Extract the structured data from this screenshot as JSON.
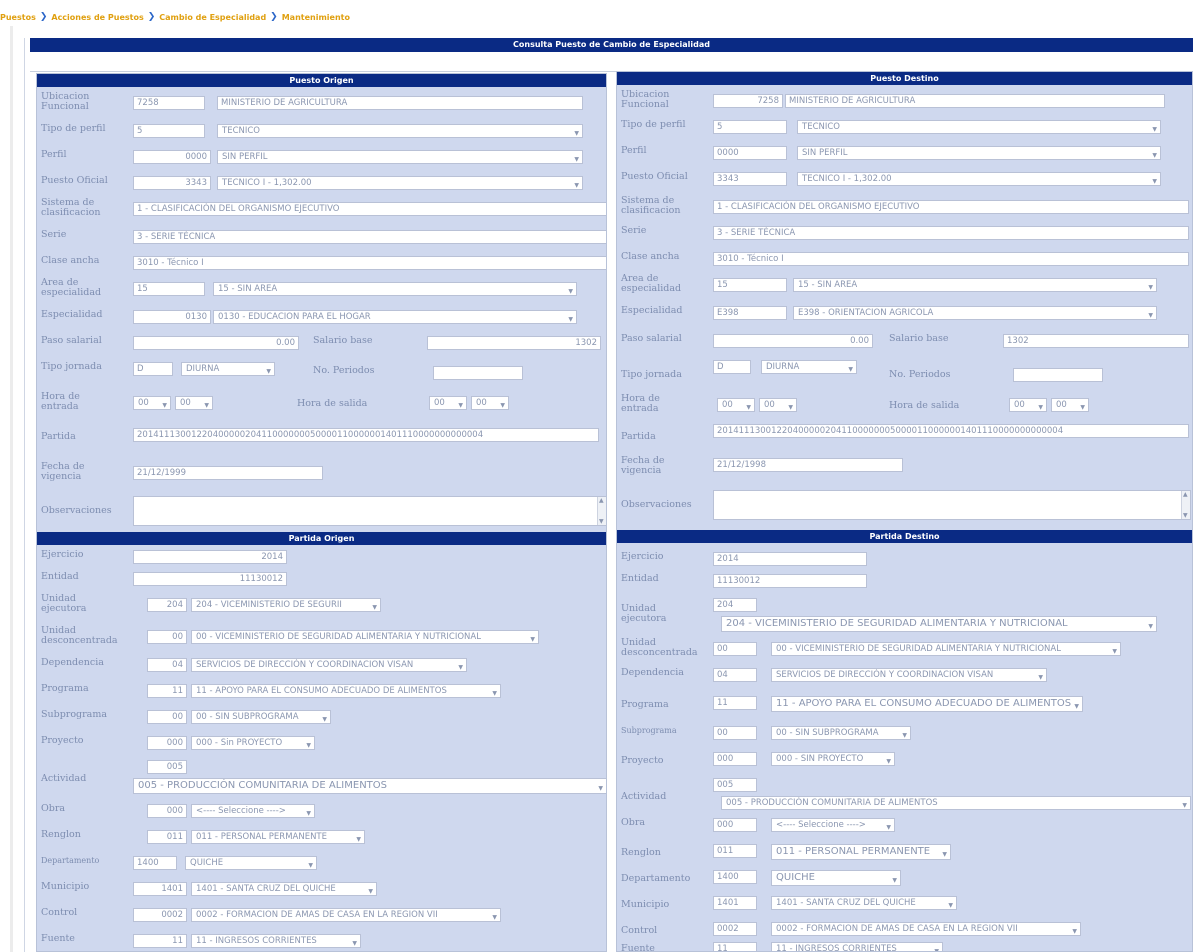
{
  "breadcrumb": [
    "Puestos",
    "Acciones de Puestos",
    "Cambio de Especialidad",
    "Mantenimiento"
  ],
  "page_title": "Consulta Puesto de Cambio de Especialidad",
  "origen": {
    "title": "Puesto Origen",
    "labels": {
      "ubicacion": "Ubicacion Funcional",
      "tipo_perfil": "Tipo de perfil",
      "perfil": "Perfil",
      "puesto_oficial": "Puesto Oficial",
      "sistema": "Sistema de clasificacion",
      "serie": "Serie",
      "clase_ancha": "Clase ancha",
      "area": "Area de especialidad",
      "especialidad": "Especialidad",
      "paso_salarial": "Paso salarial",
      "salario_base": "Salario base",
      "tipo_jornada": "Tipo jornada",
      "no_periodos": "No. Periodos",
      "hora_entrada": "Hora de entrada",
      "hora_salida": "Hora de salida",
      "partida": "Partida",
      "fecha_vigencia": "Fecha de vigencia",
      "observaciones": "Observaciones"
    },
    "values": {
      "ubicacion_code": "7258",
      "ubicacion_desc": "MINISTERIO DE AGRICULTURA",
      "tipo_perfil_code": "5",
      "tipo_perfil_desc": "TECNICO",
      "perfil_code": "0000",
      "perfil_desc": "SIN PERFIL",
      "puesto_code": "3343",
      "puesto_desc": "TECNICO I - 1,302.00",
      "sistema": "1 - CLASIFICACIÓN DEL ORGANISMO EJECUTIVO",
      "serie": "3 - SERIE TÉCNICA",
      "clase_ancha": "3010 - Técnico I",
      "area_code": "15",
      "area_desc": "15 - SIN AREA",
      "especialidad_code": "0130",
      "especialidad_desc": "0130 - EDUCACION PARA EL HOGAR",
      "paso_salarial": "0.00",
      "salario_base": "1302",
      "jornada_code": "D",
      "jornada_desc": "DIURNA",
      "no_periodos": "",
      "hora_entrada_h": "00",
      "hora_entrada_m": "00",
      "hora_salida_h": "00",
      "hora_salida_m": "00",
      "partida": "2014111300122040000020411000000050000110000001401110000000000004",
      "fecha_vigencia": "21/12/1999"
    }
  },
  "destino": {
    "title": "Puesto Destino",
    "labels": {
      "ubicacion": "Ubicacion Funcional",
      "tipo_perfil": "Tipo de perfil",
      "perfil": "Perfil",
      "puesto_oficial": "Puesto Oficial",
      "sistema": "Sistema de clasificacion",
      "serie": "Serie",
      "clase_ancha": "Clase ancha",
      "area": "Area de especialidad",
      "especialidad": "Especialidad",
      "paso_salarial": "Paso salarial",
      "salario_base": "Salario base",
      "tipo_jornada": "Tipo jornada",
      "no_periodos": "No. Periodos",
      "hora_entrada": "Hora de entrada",
      "hora_salida": "Hora de salida",
      "partida": "Partida",
      "fecha_vigencia": "Fecha de vigencia",
      "observaciones": "Observaciones"
    },
    "values": {
      "ubicacion_code": "7258",
      "ubicacion_desc": "MINISTERIO DE AGRICULTURA",
      "tipo_perfil_code": "5",
      "tipo_perfil_desc": "TECNICO",
      "perfil_code": "0000",
      "perfil_desc": "SIN PERFIL",
      "puesto_code": "3343",
      "puesto_desc": "TECNICO I - 1,302.00",
      "sistema": "1 - CLASIFICACIÓN DEL ORGANISMO EJECUTIVO",
      "serie": "3 - SERIE TÉCNICA",
      "clase_ancha": "3010 - Técnico I",
      "area_code": "15",
      "area_desc": "15 - SIN AREA",
      "especialidad_code": "E398",
      "especialidad_desc": "E398 - ORIENTACION AGRICOLA",
      "paso_salarial": "0.00",
      "salario_base": "1302",
      "jornada_code": "D",
      "jornada_desc": "DIURNA",
      "no_periodos": "",
      "hora_entrada_h": "00",
      "hora_entrada_m": "00",
      "hora_salida_h": "00",
      "hora_salida_m": "00",
      "partida": "2014111300122040000020411000000050000110000001401110000000000004",
      "fecha_vigencia": "21/12/1998"
    }
  },
  "partida_origen": {
    "title": "Partida Origen",
    "labels": {
      "ejercicio": "Ejercicio",
      "entidad": "Entidad",
      "unidad_ejecutora": "Unidad ejecutora",
      "unidad_desconcentrada": "Unidad desconcentrada",
      "dependencia": "Dependencia",
      "programa": "Programa",
      "subprograma": "Subprograma",
      "proyecto": "Proyecto",
      "actividad": "Actividad",
      "obra": "Obra",
      "renglon": "Renglon",
      "departamento": "Departamento",
      "municipio": "Municipio",
      "control": "Control",
      "fuente": "Fuente"
    },
    "values": {
      "ejercicio": "2014",
      "entidad": "11130012",
      "ue_code": "204",
      "ue_desc": "204 - VICEMINISTERIO DE SEGURII",
      "ud_code": "00",
      "ud_desc": "00 - VICEMINISTERIO DE SEGURIDAD ALIMENTARIA Y NUTRICIONAL",
      "dep_code": "04",
      "dep_desc": "SERVICIOS DE DIRECCIÓN Y COORDINACION VISAN",
      "prog_code": "11",
      "prog_desc": "11 - APOYO PARA EL CONSUMO ADECUADO DE ALIMENTOS",
      "subprog_code": "00",
      "subprog_desc": "00 - SIN SUBPROGRAMA",
      "proy_code": "000",
      "proy_desc": "000 - Sin PROYECTO",
      "act_code": "005",
      "act_desc": "005 - PRODUCCIÓN COMUNITARIA DE ALIMENTOS",
      "obra_code": "000",
      "obra_desc": "<---- Seleccione ---->",
      "renglon_code": "011",
      "renglon_desc": "011 - PERSONAL PERMANENTE",
      "depto_code": "1400",
      "depto_desc": "QUICHE",
      "muni_code": "1401",
      "muni_desc": "1401 - SANTA CRUZ DEL QUICHE",
      "control_code": "0002",
      "control_desc": "0002 - FORMACION DE AMAS DE CASA EN LA REGION VII",
      "fuente_code": "11",
      "fuente_desc": "11 - INGRESOS CORRIENTES"
    }
  },
  "partida_destino": {
    "title": "Partida Destino",
    "labels": {
      "ejercicio": "Ejercicio",
      "entidad": "Entidad",
      "unidad_ejecutora": "Unidad ejecutora",
      "unidad_desconcentrada": "Unidad desconcentrada",
      "dependencia": "Dependencia",
      "programa": "Programa",
      "subprograma": "Subprograma",
      "proyecto": "Proyecto",
      "actividad": "Actividad",
      "obra": "Obra",
      "renglon": "Renglon",
      "departamento": "Departamento",
      "municipio": "Municipio",
      "control": "Control",
      "fuente": "Fuente"
    },
    "values": {
      "ejercicio": "2014",
      "entidad": "11130012",
      "ue_code": "204",
      "ue_desc": "204 - VICEMINISTERIO DE SEGURIDAD ALIMENTARIA Y NUTRICIONAL",
      "ud_code": "00",
      "ud_desc": "00 - VICEMINISTERIO DE SEGURIDAD ALIMENTARIA Y NUTRICIONAL",
      "dep_code": "04",
      "dep_desc": "SERVICIOS DE DIRECCIÓN Y COORDINACION VISAN",
      "prog_code": "11",
      "prog_desc": "11 - APOYO PARA EL CONSUMO ADECUADO DE ALIMENTOS",
      "subprog_code": "00",
      "subprog_desc": "00 - SIN SUBPROGRAMA",
      "proy_code": "000",
      "proy_desc": "000 - SIN PROYECTO",
      "act_code": "005",
      "act_desc": "005 - PRODUCCIÓN COMUNITARIA DE ALIMENTOS",
      "obra_code": "000",
      "obra_desc": "<---- Seleccione ---->",
      "renglon_code": "011",
      "renglon_desc": "011 - PERSONAL PERMANENTE",
      "depto_code": "1400",
      "depto_desc": "QUICHE",
      "muni_code": "1401",
      "muni_desc": "1401 - SANTA CRUZ DEL QUICHE",
      "control_code": "0002",
      "control_desc": "0002 - FORMACION DE AMAS DE CASA EN LA REGION VII",
      "fuente_code": "11",
      "fuente_desc": "11 - INGRESOS CORRIENTES"
    }
  }
}
